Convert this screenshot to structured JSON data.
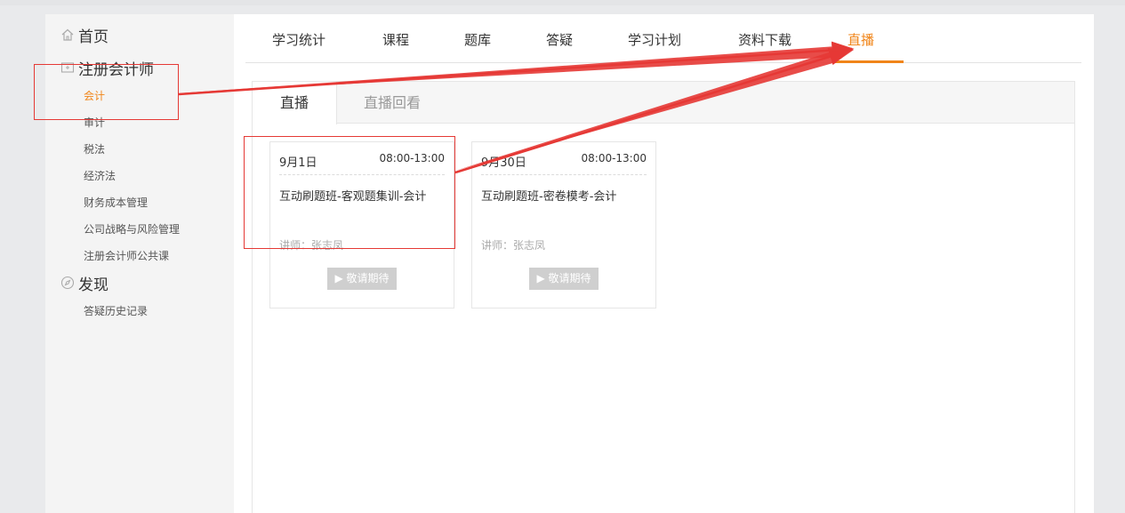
{
  "sidebar": {
    "home": {
      "label": "首页",
      "icon": "home-icon"
    },
    "cpa": {
      "label": "注册会计师",
      "icon": "folder-icon"
    },
    "subjects": [
      "会计",
      "审计",
      "税法",
      "经济法",
      "财务成本管理",
      "公司战略与风险管理",
      "注册会计师公共课"
    ],
    "active_subject_index": 0,
    "discover": {
      "label": "发现",
      "icon": "compass-icon"
    },
    "discover_items": [
      "答疑历史记录"
    ]
  },
  "tabs": [
    "学习统计",
    "课程",
    "题库",
    "答疑",
    "学习计划",
    "资料下载",
    "直播"
  ],
  "active_tab": "直播",
  "subtabs": {
    "active": "直播",
    "inactive": "直播回看"
  },
  "cards": [
    {
      "date": "9月1日",
      "time": "08:00-13:00",
      "title": "互动刷题班-客观题集训-会计",
      "teacher": "讲师：张志凤",
      "button": "▶ 敬请期待"
    },
    {
      "date": "9月30日",
      "time": "08:00-13:00",
      "title": "互动刷题班-密卷模考-会计",
      "teacher": "讲师：张志凤",
      "button": "▶ 敬请期待"
    }
  ],
  "colors": {
    "accent": "#f08519",
    "annotation": "#e53935",
    "sidebar_bg": "#f4f4f4"
  }
}
